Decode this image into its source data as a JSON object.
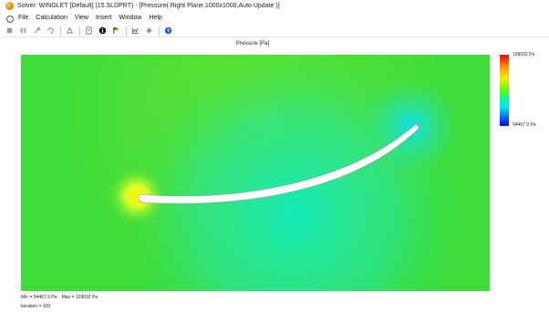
{
  "window": {
    "title": "Solver: WINGLET [Default] (15.SLDPRT) - [Pressure( Right Plane,1000x1000,Auto Update )]"
  },
  "menu": {
    "items": [
      "File",
      "Calculation",
      "View",
      "Insert",
      "Window",
      "Help"
    ]
  },
  "toolbar": {
    "icons": [
      "stop-icon",
      "pause-icon",
      "pointer-icon",
      "refresh-icon",
      "goals-icon",
      "document-icon",
      "info-icon",
      "flag-icon",
      "chart-icon",
      "preview-icon",
      "help-icon"
    ]
  },
  "plot": {
    "title": "Pressure [Pa]",
    "legend_max": "109032 Pa",
    "legend_min": "94467.9 Pa",
    "min_label": "Min = 94467.9 Pa",
    "max_label": "Max = 109032 Pa",
    "iteration_label": "Iteration = 100"
  },
  "colors": {
    "field_green": "#3ddc3a",
    "high_pressure": "#ffe600",
    "low_pressure": "#00e8c0",
    "legend_top": "#ff0000",
    "legend_bottom": "#0000ff"
  }
}
